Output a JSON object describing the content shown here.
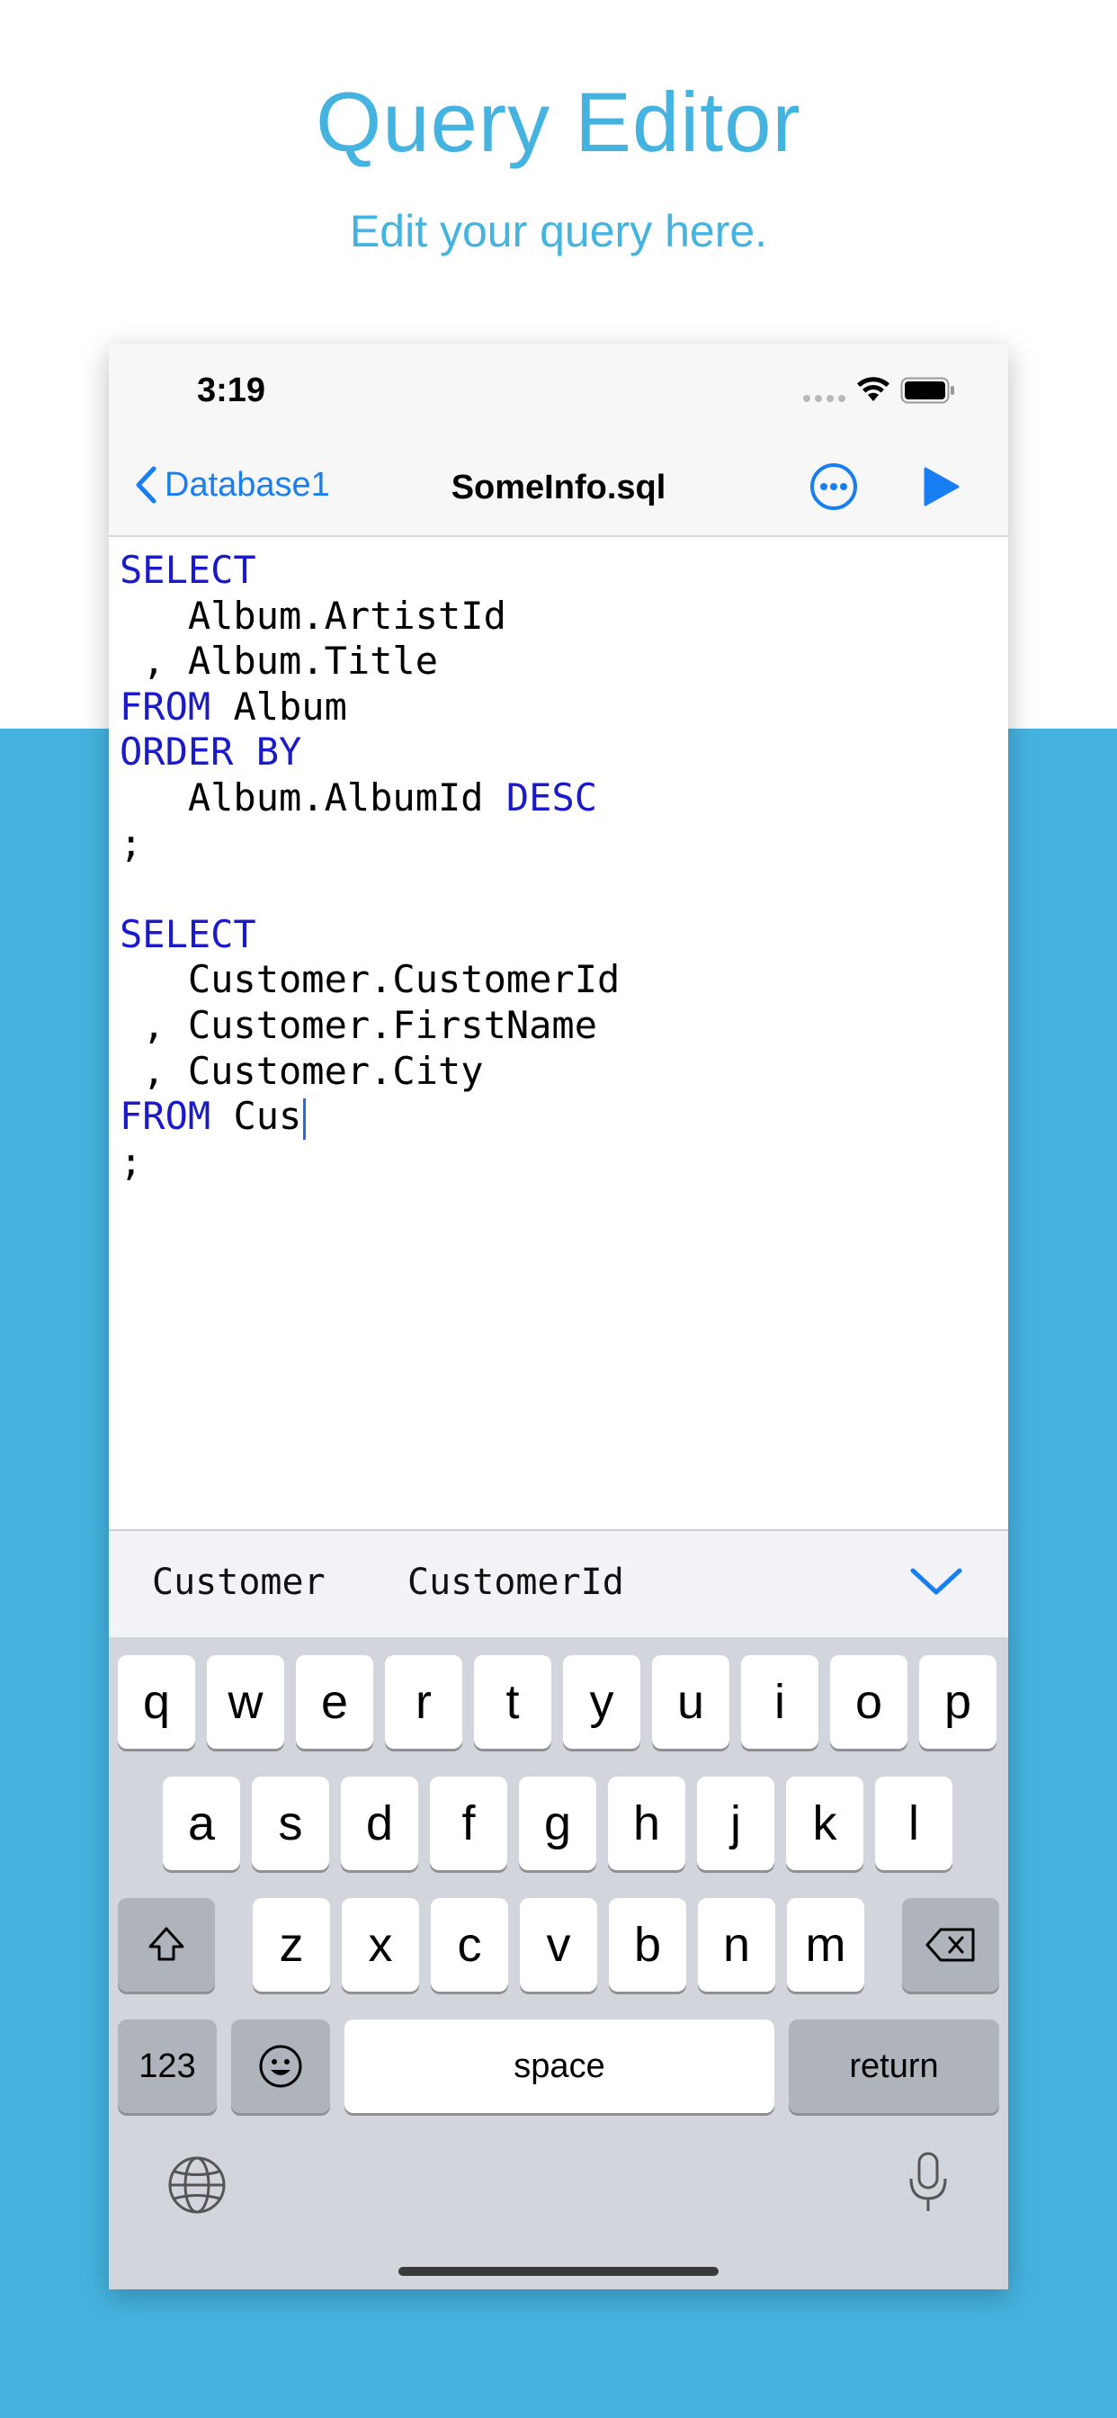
{
  "promo": {
    "title": "Query Editor",
    "subtitle": "Edit your query here."
  },
  "status_bar": {
    "time": "3:19",
    "icons": [
      "signal-dots-icon",
      "wifi-icon",
      "battery-icon"
    ]
  },
  "nav": {
    "back_label": "Database1",
    "title": "SomeInfo.sql",
    "buttons": [
      "more-icon",
      "play-icon"
    ]
  },
  "editor": {
    "lines": [
      [
        {
          "t": "SELECT",
          "k": true
        }
      ],
      [
        {
          "t": "   Album.ArtistId",
          "k": false
        }
      ],
      [
        {
          "t": " , Album.Title",
          "k": false
        }
      ],
      [
        {
          "t": "FROM",
          "k": true
        },
        {
          "t": " Album",
          "k": false
        }
      ],
      [
        {
          "t": "ORDER BY",
          "k": true
        }
      ],
      [
        {
          "t": "   Album.AlbumId ",
          "k": false
        },
        {
          "t": "DESC",
          "k": true
        }
      ],
      [
        {
          "t": ";",
          "k": false
        }
      ],
      [],
      [
        {
          "t": "SELECT",
          "k": true
        }
      ],
      [
        {
          "t": "   Customer.CustomerId",
          "k": false
        }
      ],
      [
        {
          "t": " , Customer.FirstName",
          "k": false
        }
      ],
      [
        {
          "t": " , Customer.City",
          "k": false
        }
      ],
      [
        {
          "t": "FROM",
          "k": true
        },
        {
          "t": " Cus",
          "k": false,
          "caret": true
        }
      ],
      [
        {
          "t": ";",
          "k": false
        }
      ]
    ]
  },
  "suggestions": {
    "items": [
      "Customer",
      "CustomerId"
    ]
  },
  "keyboard": {
    "row1": [
      "q",
      "w",
      "e",
      "r",
      "t",
      "y",
      "u",
      "i",
      "o",
      "p"
    ],
    "row2": [
      "a",
      "s",
      "d",
      "f",
      "g",
      "h",
      "j",
      "k",
      "l"
    ],
    "row3": [
      "z",
      "x",
      "c",
      "v",
      "b",
      "n",
      "m"
    ],
    "numbers_label": "123",
    "space_label": "space",
    "return_label": "return"
  },
  "colors": {
    "accent": "#45b3e0",
    "ios_blue": "#1a7ef3",
    "keyword": "#1a1acb"
  }
}
